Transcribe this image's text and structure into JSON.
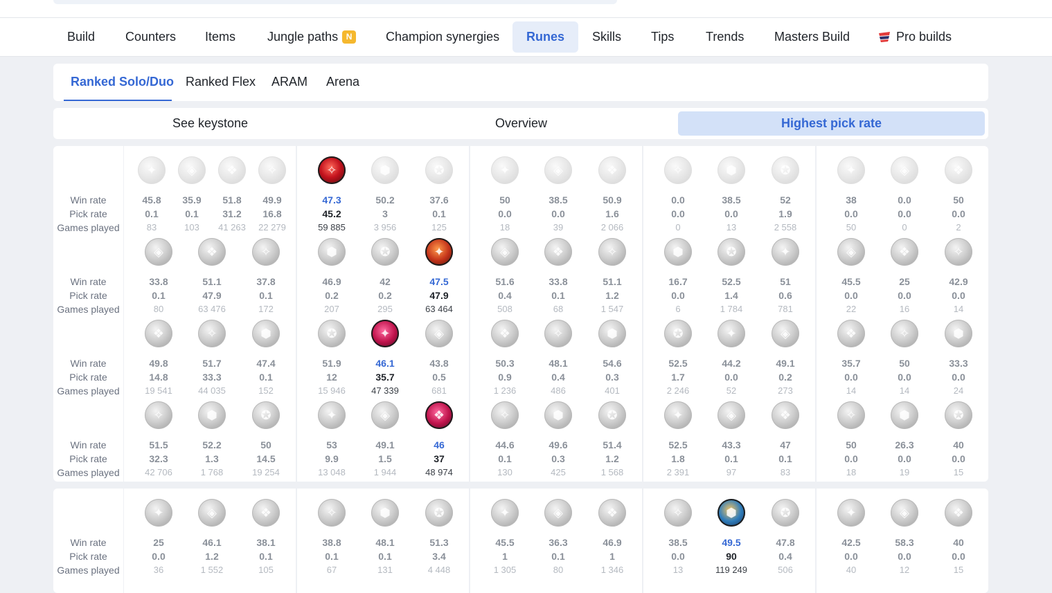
{
  "nav": {
    "items": [
      {
        "label": "Build",
        "active": false
      },
      {
        "label": "Counters",
        "active": false
      },
      {
        "label": "Items",
        "active": false
      },
      {
        "label": "Jungle paths",
        "active": false,
        "badge": "N"
      },
      {
        "label": "Champion synergies",
        "active": false
      },
      {
        "label": "Runes",
        "active": true
      },
      {
        "label": "Skills",
        "active": false
      },
      {
        "label": "Tips",
        "active": false
      },
      {
        "label": "Trends",
        "active": false
      },
      {
        "label": "Masters Build",
        "active": false
      },
      {
        "label": "Pro builds",
        "active": false,
        "icon": "pro-builds-logo-icon"
      }
    ]
  },
  "queues": [
    {
      "label": "Ranked Solo/Duo",
      "active": true
    },
    {
      "label": "Ranked Flex",
      "active": false
    },
    {
      "label": "ARAM",
      "active": false
    },
    {
      "label": "Arena",
      "active": false
    }
  ],
  "modes": [
    {
      "label": "See keystone",
      "active": false
    },
    {
      "label": "Overview",
      "active": false
    },
    {
      "label": "Highest pick rate",
      "active": true
    }
  ],
  "row_labels": {
    "win": "Win rate",
    "pick": "Pick rate",
    "games": "Games played"
  },
  "colors": {
    "accent": "#3568d4",
    "badge": "#f5b82e",
    "muted": "#8a9099"
  },
  "sections": [
    {
      "rows": [
        [
          [
            {
              "w": "45.8",
              "p": "0.1",
              "g": "83",
              "icon": "keystone-press-the-attack-icon"
            },
            {
              "w": "35.9",
              "p": "0.1",
              "g": "103",
              "icon": "keystone-lethal-tempo-icon"
            },
            {
              "w": "51.8",
              "p": "31.2",
              "g": "41 263",
              "icon": "keystone-fleet-footwork-icon"
            },
            {
              "w": "49.9",
              "p": "16.8",
              "g": "22 279",
              "icon": "keystone-conqueror-icon"
            }
          ],
          [
            {
              "w": "47.3",
              "p": "45.2",
              "g": "59 885",
              "sel": "red",
              "icon": "keystone-electrocute-icon"
            },
            {
              "w": "50.2",
              "p": "3",
              "g": "3 956",
              "icon": "keystone-dark-harvest-icon"
            },
            {
              "w": "37.6",
              "p": "0.1",
              "g": "125",
              "icon": "keystone-hail-of-blades-icon"
            }
          ],
          [
            {
              "w": "50",
              "p": "0.0",
              "g": "18",
              "icon": "keystone-summon-aery-icon"
            },
            {
              "w": "38.5",
              "p": "0.0",
              "g": "39",
              "icon": "keystone-arcane-comet-icon"
            },
            {
              "w": "50.9",
              "p": "1.6",
              "g": "2 066",
              "icon": "keystone-phase-rush-icon"
            }
          ],
          [
            {
              "w": "0.0",
              "p": "0.0",
              "g": "0",
              "icon": "keystone-grasp-icon"
            },
            {
              "w": "38.5",
              "p": "0.0",
              "g": "13",
              "icon": "keystone-aftershock-icon"
            },
            {
              "w": "52",
              "p": "1.9",
              "g": "2 558",
              "icon": "keystone-guardian-icon"
            }
          ],
          [
            {
              "w": "38",
              "p": "0.0",
              "g": "50",
              "icon": "keystone-glacial-augment-icon"
            },
            {
              "w": "0.0",
              "p": "0.0",
              "g": "0",
              "icon": "keystone-unsealed-spellbook-icon"
            },
            {
              "w": "50",
              "p": "0.0",
              "g": "2",
              "icon": "keystone-first-strike-icon"
            }
          ]
        ],
        [
          [
            {
              "w": "33.8",
              "p": "0.1",
              "g": "80",
              "icon": "overheal-icon"
            },
            {
              "w": "51.1",
              "p": "47.9",
              "g": "63 476",
              "icon": "triumph-icon"
            },
            {
              "w": "37.8",
              "p": "0.1",
              "g": "172",
              "icon": "presence-of-mind-icon"
            }
          ],
          [
            {
              "w": "46.9",
              "p": "0.2",
              "g": "207",
              "icon": "cheap-shot-icon"
            },
            {
              "w": "42",
              "p": "0.2",
              "g": "295",
              "icon": "taste-of-blood-icon"
            },
            {
              "w": "47.5",
              "p": "47.9",
              "g": "63 464",
              "sel": "orange",
              "icon": "sudden-impact-icon"
            }
          ],
          [
            {
              "w": "51.6",
              "p": "0.4",
              "g": "508",
              "icon": "axiom-arcanist-icon"
            },
            {
              "w": "33.8",
              "p": "0.1",
              "g": "68",
              "icon": "manaflow-band-icon"
            },
            {
              "w": "51.1",
              "p": "1.2",
              "g": "1 547",
              "icon": "nimbus-cloak-icon"
            }
          ],
          [
            {
              "w": "16.7",
              "p": "0.0",
              "g": "6",
              "icon": "demolish-icon"
            },
            {
              "w": "52.5",
              "p": "1.4",
              "g": "1 784",
              "icon": "font-of-life-icon"
            },
            {
              "w": "51",
              "p": "0.6",
              "g": "781",
              "icon": "shield-bash-icon"
            }
          ],
          [
            {
              "w": "45.5",
              "p": "0.0",
              "g": "22",
              "icon": "hextech-flashtraption-icon"
            },
            {
              "w": "25",
              "p": "0.0",
              "g": "16",
              "icon": "magical-footwear-icon"
            },
            {
              "w": "42.9",
              "p": "0.0",
              "g": "14",
              "icon": "cash-back-icon"
            }
          ]
        ],
        [
          [
            {
              "w": "49.8",
              "p": "14.8",
              "g": "19 541",
              "icon": "legend-alacrity-icon"
            },
            {
              "w": "51.7",
              "p": "33.3",
              "g": "44 035",
              "icon": "legend-haste-icon"
            },
            {
              "w": "47.4",
              "p": "0.1",
              "g": "152",
              "icon": "legend-bloodline-icon"
            }
          ],
          [
            {
              "w": "51.9",
              "p": "12",
              "g": "15 946",
              "icon": "zombie-ward-icon"
            },
            {
              "w": "46.1",
              "p": "35.7",
              "g": "47 339",
              "sel": "pink",
              "icon": "eyeball-collection-icon"
            },
            {
              "w": "43.8",
              "p": "0.5",
              "g": "681",
              "icon": "ghost-poro-icon"
            }
          ],
          [
            {
              "w": "50.3",
              "p": "0.9",
              "g": "1 236",
              "icon": "transcendence-icon"
            },
            {
              "w": "48.1",
              "p": "0.4",
              "g": "486",
              "icon": "celerity-icon"
            },
            {
              "w": "54.6",
              "p": "0.3",
              "g": "401",
              "icon": "absolute-focus-icon"
            }
          ],
          [
            {
              "w": "52.5",
              "p": "1.7",
              "g": "2 246",
              "icon": "conditioning-icon"
            },
            {
              "w": "44.2",
              "p": "0.0",
              "g": "52",
              "icon": "second-wind-icon"
            },
            {
              "w": "49.1",
              "p": "0.2",
              "g": "273",
              "icon": "bone-plating-icon"
            }
          ],
          [
            {
              "w": "35.7",
              "p": "0.0",
              "g": "14",
              "icon": "triple-tonic-icon"
            },
            {
              "w": "50",
              "p": "0.0",
              "g": "14",
              "icon": "time-warp-tonic-icon"
            },
            {
              "w": "33.3",
              "p": "0.0",
              "g": "24",
              "icon": "biscuit-delivery-icon"
            }
          ]
        ],
        [
          [
            {
              "w": "51.5",
              "p": "32.3",
              "g": "42 706",
              "icon": "coup-de-grace-icon"
            },
            {
              "w": "52.2",
              "p": "1.3",
              "g": "1 768",
              "icon": "cut-down-icon"
            },
            {
              "w": "50",
              "p": "14.5",
              "g": "19 254",
              "icon": "last-stand-icon"
            }
          ],
          [
            {
              "w": "53",
              "p": "9.9",
              "g": "13 048",
              "icon": "treasure-hunter-icon"
            },
            {
              "w": "49.1",
              "p": "1.5",
              "g": "1 944",
              "icon": "relentless-hunter-icon"
            },
            {
              "w": "46",
              "p": "37",
              "g": "48 974",
              "sel": "pink",
              "icon": "ultimate-hunter-icon"
            }
          ],
          [
            {
              "w": "44.6",
              "p": "0.1",
              "g": "130",
              "icon": "scorch-icon"
            },
            {
              "w": "49.6",
              "p": "0.3",
              "g": "425",
              "icon": "waterwalking-icon"
            },
            {
              "w": "51.4",
              "p": "1.2",
              "g": "1 568",
              "icon": "gathering-storm-icon"
            }
          ],
          [
            {
              "w": "52.5",
              "p": "1.8",
              "g": "2 391",
              "icon": "overgrowth-icon"
            },
            {
              "w": "43.3",
              "p": "0.1",
              "g": "97",
              "icon": "revitalize-icon"
            },
            {
              "w": "47",
              "p": "0.1",
              "g": "83",
              "icon": "unflinching-icon"
            }
          ],
          [
            {
              "w": "50",
              "p": "0.0",
              "g": "18",
              "icon": "cosmic-insight-icon"
            },
            {
              "w": "26.3",
              "p": "0.0",
              "g": "19",
              "icon": "approach-velocity-icon"
            },
            {
              "w": "40",
              "p": "0.0",
              "g": "15",
              "icon": "jack-of-all-trades-icon"
            }
          ]
        ]
      ]
    },
    {
      "rows": [
        [
          [
            {
              "w": "25",
              "p": "0.0",
              "g": "36",
              "icon": "overheal-icon"
            },
            {
              "w": "46.1",
              "p": "1.2",
              "g": "1 552",
              "icon": "triumph-icon"
            },
            {
              "w": "38.1",
              "p": "0.1",
              "g": "105",
              "icon": "presence-of-mind-icon"
            }
          ],
          [
            {
              "w": "38.8",
              "p": "0.1",
              "g": "67",
              "icon": "cheap-shot-icon"
            },
            {
              "w": "48.1",
              "p": "0.1",
              "g": "131",
              "icon": "taste-of-blood-icon"
            },
            {
              "w": "51.3",
              "p": "3.4",
              "g": "4 448",
              "icon": "sudden-impact-icon"
            }
          ],
          [
            {
              "w": "45.5",
              "p": "1",
              "g": "1 305",
              "icon": "axiom-arcanist-icon"
            },
            {
              "w": "36.3",
              "p": "0.1",
              "g": "80",
              "icon": "manaflow-band-icon"
            },
            {
              "w": "46.9",
              "p": "1",
              "g": "1 346",
              "icon": "nimbus-cloak-icon"
            }
          ],
          [
            {
              "w": "38.5",
              "p": "0.0",
              "g": "13",
              "icon": "demolish-icon"
            },
            {
              "w": "49.5",
              "p": "90",
              "g": "119 249",
              "sel": "blue",
              "icon": "font-of-life-icon"
            },
            {
              "w": "47.8",
              "p": "0.4",
              "g": "506",
              "icon": "shield-bash-icon"
            }
          ],
          [
            {
              "w": "42.5",
              "p": "0.0",
              "g": "40",
              "icon": "hextech-flashtraption-icon"
            },
            {
              "w": "58.3",
              "p": "0.0",
              "g": "12",
              "icon": "magical-footwear-icon"
            },
            {
              "w": "40",
              "p": "0.0",
              "g": "15",
              "icon": "cash-back-icon"
            }
          ]
        ]
      ]
    }
  ]
}
